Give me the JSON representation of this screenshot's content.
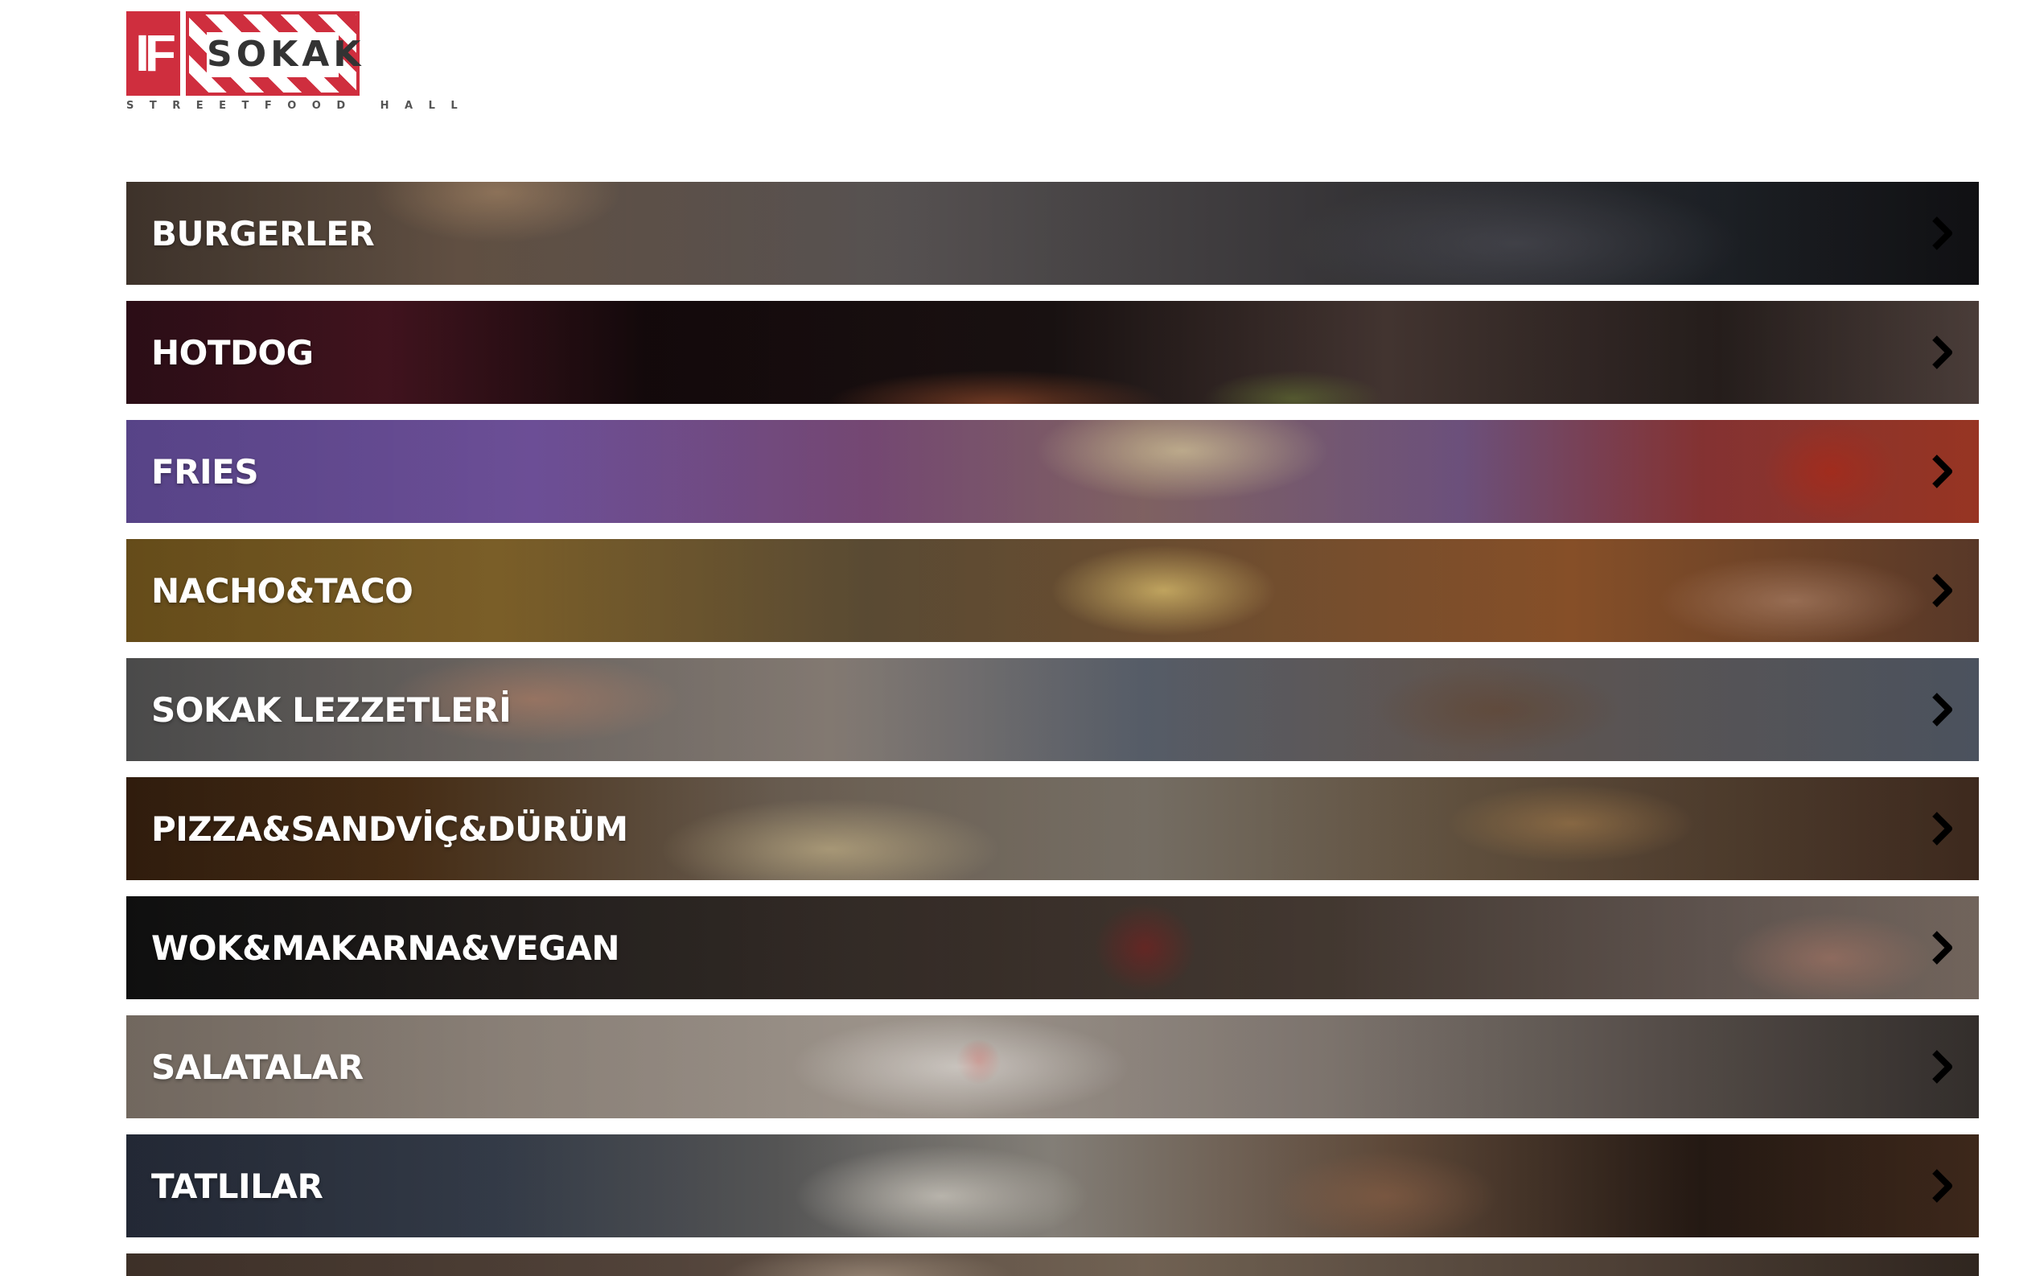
{
  "logo": {
    "mark_left": "IF",
    "mark_right": "SOKAK",
    "subtitle": "STREETFOOD HALL"
  },
  "menu": {
    "items": [
      {
        "label": "BURGERLER"
      },
      {
        "label": "HOTDOG"
      },
      {
        "label": "FRIES"
      },
      {
        "label": "NACHO&TACO"
      },
      {
        "label": "SOKAK LEZZETLERİ"
      },
      {
        "label": "PIZZA&SANDVİÇ&DÜRÜM"
      },
      {
        "label": "WOK&MAKARNA&VEGAN"
      },
      {
        "label": "SALATALAR"
      },
      {
        "label": "TATLILAR"
      },
      {
        "label": ""
      }
    ],
    "arrow_icon": "chevron-right-icon"
  },
  "colors": {
    "brand_red": "#cf2e3e",
    "logo_text": "#333333",
    "label_text": "#ffffff",
    "arrow": "#000000"
  }
}
